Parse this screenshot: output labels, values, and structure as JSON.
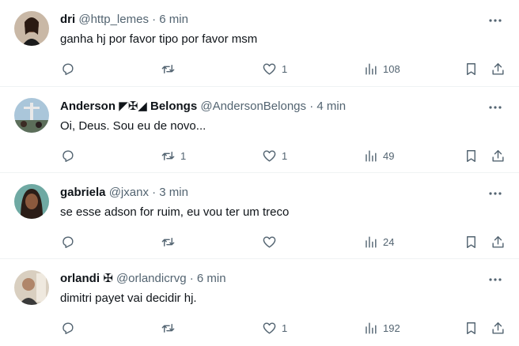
{
  "tweets": [
    {
      "name": "dri",
      "badge": "",
      "name_suffix": "",
      "handle": "@http_lemes",
      "dot": "·",
      "time": "6 min",
      "text": "ganha hj por favor tipo por favor msm",
      "replies": "",
      "retweets": "",
      "likes": "1",
      "views": "108"
    },
    {
      "name": "Anderson",
      "badge": "◤✠◢",
      "name_suffix": "Belongs",
      "handle": "@AndersonBelongs",
      "dot": "·",
      "time": "4 min",
      "text": "Oi, Deus. Sou eu de novo...",
      "replies": "",
      "retweets": "1",
      "likes": "1",
      "views": "49"
    },
    {
      "name": "gabriela",
      "badge": "",
      "name_suffix": "",
      "handle": "@jxanx",
      "dot": "·",
      "time": "3 min",
      "text": "se esse adson for ruim, eu vou ter um treco",
      "replies": "",
      "retweets": "",
      "likes": "",
      "views": "24"
    },
    {
      "name": "orlandi",
      "badge": "✠",
      "name_suffix": "",
      "handle": "@orlandicrvg",
      "dot": "·",
      "time": "6 min",
      "text": "dimitri payet vai decidir hj.",
      "replies": "",
      "retweets": "",
      "likes": "1",
      "views": "192"
    }
  ],
  "icons": {
    "reply": "reply-icon",
    "retweet": "retweet-icon",
    "like": "heart-icon",
    "views": "views-icon",
    "bookmark": "bookmark-icon",
    "share": "share-icon",
    "more": "more-icon"
  },
  "colors": {
    "text": "#0f1419",
    "secondary": "#536471",
    "divider": "#eff3f4"
  }
}
